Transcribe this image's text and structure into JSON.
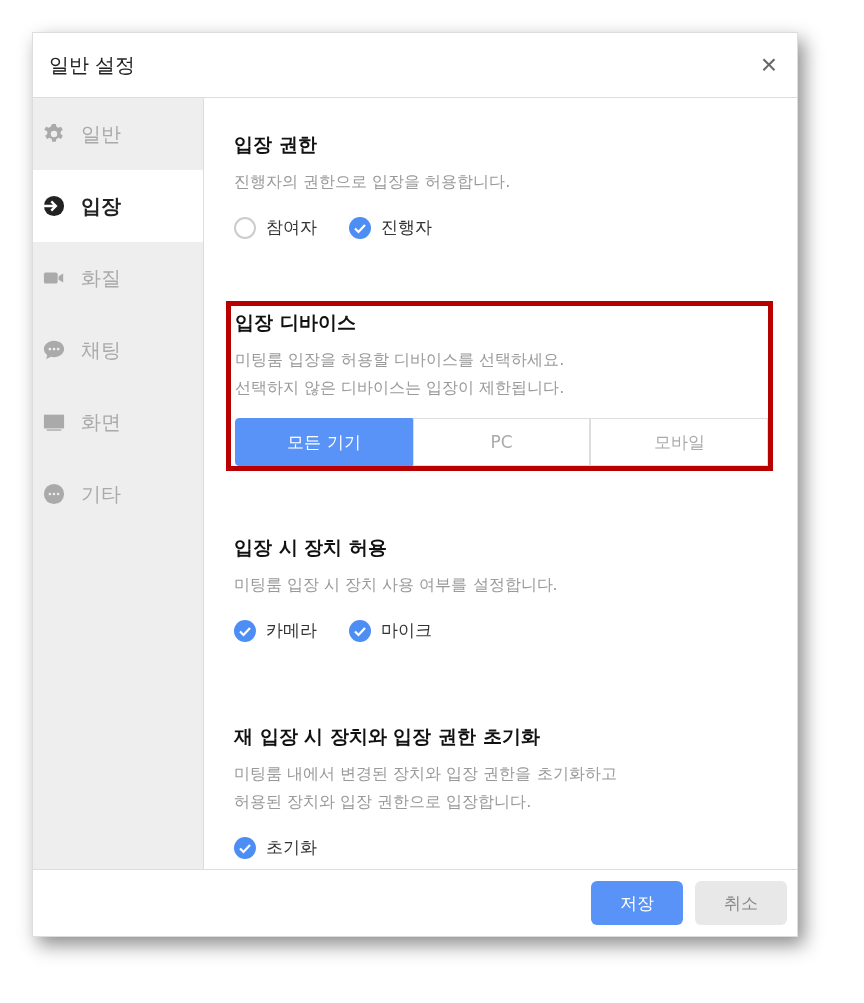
{
  "dialog": {
    "title": "일반 설정",
    "close": "×"
  },
  "sidebar": {
    "items": [
      {
        "label": "일반",
        "kind": "gear",
        "selected": false
      },
      {
        "label": "입장",
        "kind": "enter",
        "selected": true
      },
      {
        "label": "화질",
        "kind": "video",
        "selected": false
      },
      {
        "label": "채팅",
        "kind": "chat",
        "selected": false
      },
      {
        "label": "화면",
        "kind": "monitor",
        "selected": false
      },
      {
        "label": "기타",
        "kind": "more",
        "selected": false
      }
    ]
  },
  "sections": [
    {
      "kind": "radio",
      "title": "입장 권한",
      "description": [
        "진행자의 권한으로 입장을 허용합니다."
      ],
      "highlighted": false,
      "options": [
        {
          "label": "참여자",
          "selected": false
        },
        {
          "label": "진행자",
          "selected": true
        }
      ]
    },
    {
      "kind": "segmented",
      "title": "입장 디바이스",
      "description": [
        "미팅룸 입장을 허용할 디바이스를 선택하세요.",
        "선택하지 않은 디바이스는 입장이 제한됩니다."
      ],
      "highlighted": true,
      "options": [
        {
          "label": "모든 기기",
          "selected": true
        },
        {
          "label": "PC",
          "selected": false
        },
        {
          "label": "모바일",
          "selected": false
        }
      ]
    },
    {
      "kind": "checkbox",
      "title": "입장 시 장치 허용",
      "description": [
        "미팅룸 입장 시 장치 사용 여부를 설정합니다."
      ],
      "highlighted": false,
      "options": [
        {
          "label": "카메라",
          "checked": true
        },
        {
          "label": "마이크",
          "checked": true
        }
      ]
    },
    {
      "kind": "checkbox",
      "title": "재 입장 시 장치와 입장 권한 초기화",
      "description": [
        "미팅룸 내에서 변경된 장치와 입장 권한을 초기화하고",
        "허용된 장치와 입장 권한으로 입장합니다."
      ],
      "highlighted": false,
      "options": [
        {
          "label": "초기화",
          "checked": true
        }
      ]
    }
  ],
  "footer": {
    "buttons": [
      {
        "label": "저장",
        "kind": "primary"
      },
      {
        "label": "취소",
        "kind": "secondary"
      }
    ]
  }
}
